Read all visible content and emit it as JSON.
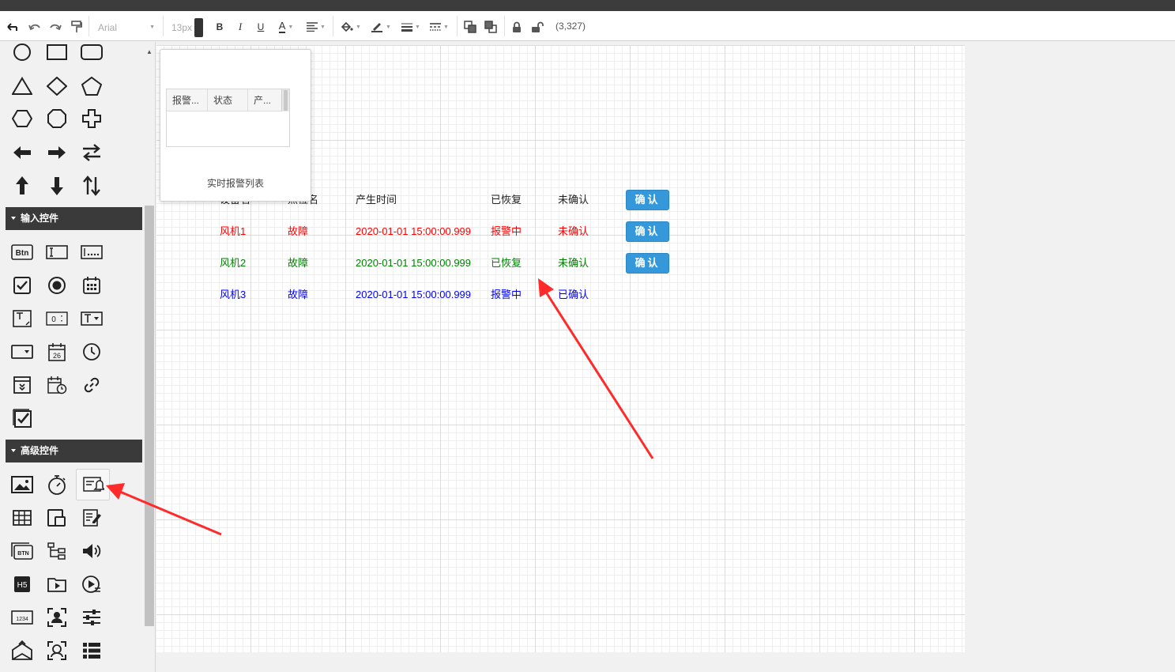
{
  "toolbar": {
    "font_family": "Arial",
    "font_size": "13px",
    "bold_label": "B",
    "italic_label": "I",
    "underline_label": "U",
    "font_color_label": "A",
    "coords": "(3,327)"
  },
  "sidebar": {
    "input_section_title": "输入控件",
    "advanced_section_title": "高级控件",
    "btn_icon_label": "Btn",
    "numeric_icon_label": "0",
    "calendar_icon_label": "26",
    "h5_icon_label": "H5",
    "btn2_icon_label": "BTN",
    "numeric2_icon_label": "1234"
  },
  "popup": {
    "columns": [
      "报警...",
      "状态",
      "产..."
    ],
    "caption": "实时报警列表"
  },
  "alarm_table": {
    "header": [
      "设备名",
      "点位名",
      "产生时间",
      "已恢复",
      "未确认"
    ],
    "confirm_label": "确认",
    "rows": [
      {
        "device": "风机1",
        "point": "故障",
        "time": "2020-01-01 15:00:00.999",
        "state": "报警中",
        "ack": "未确认",
        "color": "#ff0000",
        "has_button": true
      },
      {
        "device": "风机2",
        "point": "故障",
        "time": "2020-01-01 15:00:00.999",
        "state": "已恢复",
        "ack": "未确认",
        "color": "#008000",
        "has_button": true
      },
      {
        "device": "风机3",
        "point": "故障",
        "time": "2020-01-01 15:00:00.999",
        "state": "报警中",
        "ack": "已确认",
        "color": "#0000ff",
        "has_button": false
      }
    ]
  },
  "annotation_color": "#ff2a2a"
}
